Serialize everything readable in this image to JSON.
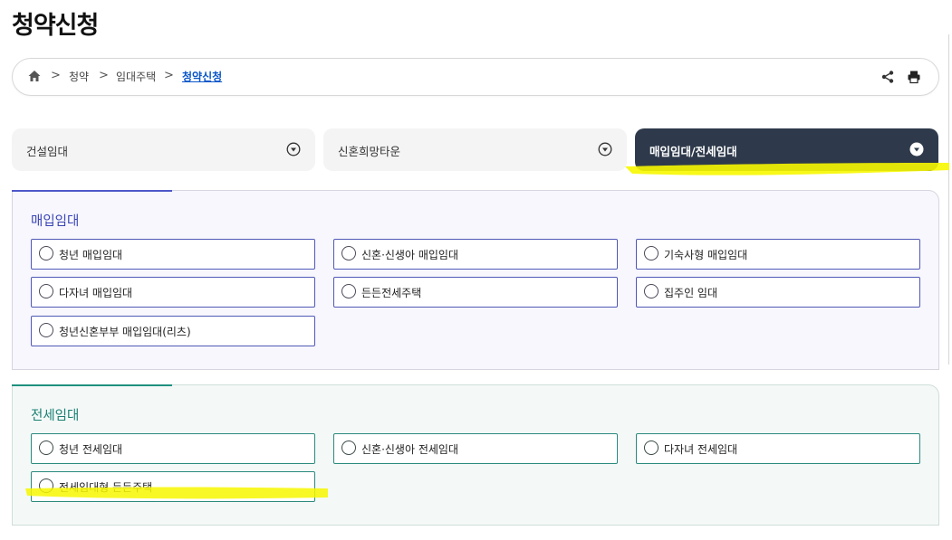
{
  "page": {
    "title": "청약신청"
  },
  "breadcrumb": {
    "items": [
      "청약",
      "임대주택",
      "청약신청"
    ],
    "separator": ">"
  },
  "toolbar": {
    "share_icon": "share-icon",
    "print_icon": "print-icon"
  },
  "tabs": [
    {
      "label": "건설임대",
      "active": false
    },
    {
      "label": "신혼희망타운",
      "active": false
    },
    {
      "label": "매입임대/전세임대",
      "active": true
    }
  ],
  "sections": [
    {
      "title": "매입임대",
      "accent": "#3b45b5",
      "options": [
        "청년 매입임대",
        "신혼·신생아 매입임대",
        "기숙사형 매입임대",
        "다자녀 매입임대",
        "든든전세주택",
        "집주인 임대",
        "청년신혼부부 매입임대(리츠)"
      ]
    },
    {
      "title": "전세임대",
      "accent": "#1b7f72",
      "options": [
        "청년 전세임대",
        "신혼·신생아 전세임대",
        "다자녀 전세임대",
        "전세임대형 든든주택"
      ]
    }
  ],
  "colors": {
    "active_tab_bg": "#2e3a4b",
    "highlight_marker": "#f7f700"
  }
}
